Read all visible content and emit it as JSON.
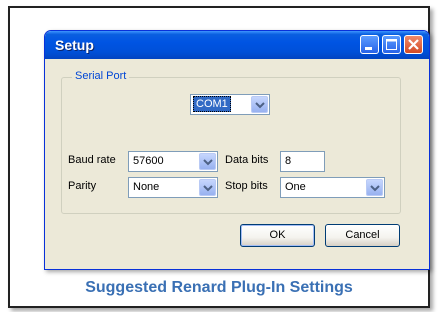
{
  "window": {
    "title": "Setup",
    "buttons": {
      "minimize": "minimize-icon",
      "maximize": "maximize-icon",
      "close": "close-icon"
    }
  },
  "serial_port": {
    "group_label": "Serial Port",
    "port": "COM1",
    "baud_rate_label": "Baud rate",
    "baud_rate": "57600",
    "data_bits_label": "Data bits",
    "data_bits": "8",
    "parity_label": "Parity",
    "parity": "None",
    "stop_bits_label": "Stop bits",
    "stop_bits": "One"
  },
  "actions": {
    "ok": "OK",
    "cancel": "Cancel"
  },
  "caption": "Suggested Renard Plug-In Settings",
  "colors": {
    "title_bar": "#0054e3",
    "group_label": "#0046d5",
    "caption": "#3a70b4"
  }
}
